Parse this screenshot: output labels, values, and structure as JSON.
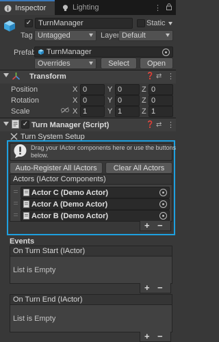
{
  "tabs": [
    {
      "label": "Inspector",
      "icon": "info-icon",
      "active": true
    },
    {
      "label": "Lighting",
      "icon": "lightbulb-icon",
      "active": false
    }
  ],
  "object": {
    "name": "TurnManager",
    "static_label": "Static",
    "tag_label": "Tag",
    "tag_value": "Untagged",
    "layer_label": "Layer",
    "layer_value": "Default",
    "prefab_label": "Prefab",
    "prefab_value": "TurnManager",
    "overrides_label": "Overrides",
    "select_label": "Select",
    "open_label": "Open"
  },
  "transform": {
    "title": "Transform",
    "rows": [
      {
        "label": "Position",
        "x": "0",
        "y": "0",
        "z": "0"
      },
      {
        "label": "Rotation",
        "x": "0",
        "y": "0",
        "z": "0"
      },
      {
        "label": "Scale",
        "x": "1",
        "y": "1",
        "z": "1"
      }
    ],
    "axes": [
      "X",
      "Y",
      "Z"
    ]
  },
  "script": {
    "title": "Turn Manager (Script)",
    "section_title": "Turn System Setup",
    "help_text_line1": "Drag your IActor components here or use the buttons",
    "help_text_line2": "below.",
    "auto_register_label": "Auto-Register All IActors",
    "clear_label": "Clear All Actors",
    "list_title": "Actors (IActor Components)",
    "actors": [
      "Actor C (Demo Actor)",
      "Actor A (Demo Actor)",
      "Actor B (Demo Actor)"
    ],
    "add_label": "+",
    "remove_label": "−"
  },
  "events": {
    "title": "Events",
    "items": [
      {
        "title": "On Turn Start (IActor)",
        "empty_text": "List is Empty"
      },
      {
        "title": "On Turn End (IActor)",
        "empty_text": "List is Empty"
      }
    ],
    "add_label": "+",
    "remove_label": "−"
  },
  "colors": {
    "highlight": "#1ea0e0",
    "tab_accent": "#3a79bb",
    "background": "#383838"
  }
}
